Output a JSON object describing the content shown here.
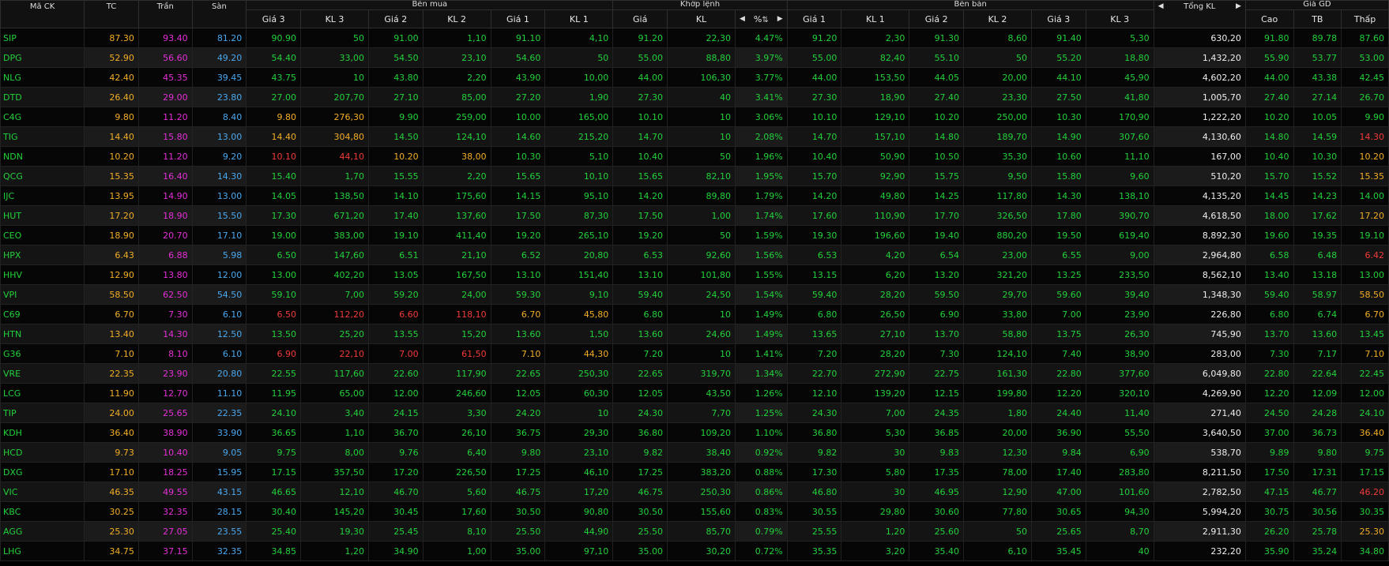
{
  "columns": {
    "symbol": "Mã CK",
    "ref": "TC",
    "ceiling": "Trần",
    "floor": "Sàn",
    "buy_group": "Bên mua",
    "match_group": "Khớp lệnh",
    "sell_group": "Bên bán",
    "total_volume": "Tổng KL",
    "price_group": "Giá GD",
    "price3": "Giá 3",
    "vol3": "KL 3",
    "price2": "Giá 2",
    "vol2": "KL 2",
    "price1": "Giá 1",
    "vol1": "KL 1",
    "match_price": "Giá",
    "match_vol": "KL",
    "change_pct": "%",
    "high": "Cao",
    "avg": "TB",
    "low": "Thấp"
  },
  "icons": {
    "left_arrow": "◀",
    "right_arrow": "▶",
    "sort": "⇅"
  },
  "colors": {
    "up": "#22d13a",
    "ref": "#f2ae25",
    "ceiling": "#e52fd8",
    "floor": "#49a8f0",
    "down": "#f23a3a",
    "neutral": "#efefef"
  },
  "rows": [
    {
      "sym": "SIP",
      "tc": "87.30",
      "ceil": "93.40",
      "floor": "81.20",
      "b3": "90.90",
      "bv3": "50",
      "b2": "91.00",
      "bv2": "1,10",
      "b1": "91.10",
      "bv1": "4,10",
      "mp": "91.20",
      "mv": "22,30",
      "pct": "4.47%",
      "s1": "91.20",
      "sv1": "2,30",
      "s2": "91.30",
      "sv2": "8,60",
      "s3": "91.40",
      "sv3": "5,30",
      "tot": "630,20",
      "hi": "91.80",
      "avg": "89.78",
      "lo": "87.60"
    },
    {
      "sym": "DPG",
      "tc": "52.90",
      "ceil": "56.60",
      "floor": "49.20",
      "b3": "54.40",
      "bv3": "33,00",
      "b2": "54.50",
      "bv2": "23,10",
      "b1": "54.60",
      "bv1": "50",
      "mp": "55.00",
      "mv": "88,80",
      "pct": "3.97%",
      "s1": "55.00",
      "sv1": "82,40",
      "s2": "55.10",
      "sv2": "50",
      "s3": "55.20",
      "sv3": "18,80",
      "tot": "1,432,20",
      "hi": "55.90",
      "avg": "53.77",
      "lo": "53.00"
    },
    {
      "sym": "NLG",
      "tc": "42.40",
      "ceil": "45.35",
      "floor": "39.45",
      "b3": "43.75",
      "bv3": "10",
      "b2": "43.80",
      "bv2": "2,20",
      "b1": "43.90",
      "bv1": "10,00",
      "mp": "44.00",
      "mv": "106,30",
      "pct": "3.77%",
      "s1": "44.00",
      "sv1": "153,50",
      "s2": "44.05",
      "sv2": "20,00",
      "s3": "44.10",
      "sv3": "45,90",
      "tot": "4,602,20",
      "hi": "44.00",
      "avg": "43.38",
      "lo": "42.45"
    },
    {
      "sym": "DTD",
      "tc": "26.40",
      "ceil": "29.00",
      "floor": "23.80",
      "b3": "27.00",
      "bv3": "207,70",
      "b2": "27.10",
      "bv2": "85,00",
      "b1": "27.20",
      "bv1": "1,90",
      "mp": "27.30",
      "mv": "40",
      "pct": "3.41%",
      "s1": "27.30",
      "sv1": "18,90",
      "s2": "27.40",
      "sv2": "23,30",
      "s3": "27.50",
      "sv3": "41,80",
      "tot": "1,005,70",
      "hi": "27.40",
      "avg": "27.14",
      "lo": "26.70"
    },
    {
      "sym": "C4G",
      "tc": "9.80",
      "ceil": "11.20",
      "floor": "8.40",
      "b3": "9.80",
      "bv3": "276,30",
      "b2": "9.90",
      "bv2": "259,00",
      "b1": "10.00",
      "bv1": "165,00",
      "mp": "10.10",
      "mv": "10",
      "pct": "3.06%",
      "s1": "10.10",
      "sv1": "129,10",
      "s2": "10.20",
      "sv2": "250,00",
      "s3": "10.30",
      "sv3": "170,90",
      "tot": "1,222,20",
      "hi": "10.20",
      "avg": "10.05",
      "lo": "9.90"
    },
    {
      "sym": "TIG",
      "tc": "14.40",
      "ceil": "15.80",
      "floor": "13.00",
      "b3": "14.40",
      "bv3": "304,80",
      "b2": "14.50",
      "bv2": "124,10",
      "b1": "14.60",
      "bv1": "215,20",
      "mp": "14.70",
      "mv": "10",
      "pct": "2.08%",
      "s1": "14.70",
      "sv1": "157,10",
      "s2": "14.80",
      "sv2": "189,70",
      "s3": "14.90",
      "sv3": "307,60",
      "tot": "4,130,60",
      "hi": "14.80",
      "avg": "14.59",
      "lo": "14.30"
    },
    {
      "sym": "NDN",
      "tc": "10.20",
      "ceil": "11.20",
      "floor": "9.20",
      "b3": "10.10",
      "bv3": "44,10",
      "b2": "10.20",
      "bv2": "38,00",
      "b1": "10.30",
      "bv1": "5,10",
      "mp": "10.40",
      "mv": "50",
      "pct": "1.96%",
      "s1": "10.40",
      "sv1": "50,90",
      "s2": "10.50",
      "sv2": "35,30",
      "s3": "10.60",
      "sv3": "11,10",
      "tot": "167,00",
      "hi": "10.40",
      "avg": "10.30",
      "lo": "10.20"
    },
    {
      "sym": "QCG",
      "tc": "15.35",
      "ceil": "16.40",
      "floor": "14.30",
      "b3": "15.40",
      "bv3": "1,70",
      "b2": "15.55",
      "bv2": "2,20",
      "b1": "15.65",
      "bv1": "10,10",
      "mp": "15.65",
      "mv": "82,10",
      "pct": "1.95%",
      "s1": "15.70",
      "sv1": "92,90",
      "s2": "15.75",
      "sv2": "9,50",
      "s3": "15.80",
      "sv3": "9,60",
      "tot": "510,20",
      "hi": "15.70",
      "avg": "15.52",
      "lo": "15.35"
    },
    {
      "sym": "IJC",
      "tc": "13.95",
      "ceil": "14.90",
      "floor": "13.00",
      "b3": "14.05",
      "bv3": "138,50",
      "b2": "14.10",
      "bv2": "175,60",
      "b1": "14.15",
      "bv1": "95,10",
      "mp": "14.20",
      "mv": "89,80",
      "pct": "1.79%",
      "s1": "14.20",
      "sv1": "49,80",
      "s2": "14.25",
      "sv2": "117,80",
      "s3": "14.30",
      "sv3": "138,10",
      "tot": "4,135,20",
      "hi": "14.45",
      "avg": "14.23",
      "lo": "14.00"
    },
    {
      "sym": "HUT",
      "tc": "17.20",
      "ceil": "18.90",
      "floor": "15.50",
      "b3": "17.30",
      "bv3": "671,20",
      "b2": "17.40",
      "bv2": "137,60",
      "b1": "17.50",
      "bv1": "87,30",
      "mp": "17.50",
      "mv": "1,00",
      "pct": "1.74%",
      "s1": "17.60",
      "sv1": "110,90",
      "s2": "17.70",
      "sv2": "326,50",
      "s3": "17.80",
      "sv3": "390,70",
      "tot": "4,618,50",
      "hi": "18.00",
      "avg": "17.62",
      "lo": "17.20"
    },
    {
      "sym": "CEO",
      "tc": "18.90",
      "ceil": "20.70",
      "floor": "17.10",
      "b3": "19.00",
      "bv3": "383,00",
      "b2": "19.10",
      "bv2": "411,40",
      "b1": "19.20",
      "bv1": "265,10",
      "mp": "19.20",
      "mv": "50",
      "pct": "1.59%",
      "s1": "19.30",
      "sv1": "196,60",
      "s2": "19.40",
      "sv2": "880,20",
      "s3": "19.50",
      "sv3": "619,40",
      "tot": "8,892,30",
      "hi": "19.60",
      "avg": "19.35",
      "lo": "19.10"
    },
    {
      "sym": "HPX",
      "tc": "6.43",
      "ceil": "6.88",
      "floor": "5.98",
      "b3": "6.50",
      "bv3": "147,60",
      "b2": "6.51",
      "bv2": "21,10",
      "b1": "6.52",
      "bv1": "20,80",
      "mp": "6.53",
      "mv": "92,60",
      "pct": "1.56%",
      "s1": "6.53",
      "sv1": "4,20",
      "s2": "6.54",
      "sv2": "23,00",
      "s3": "6.55",
      "sv3": "9,00",
      "tot": "2,964,80",
      "hi": "6.58",
      "avg": "6.48",
      "lo": "6.42"
    },
    {
      "sym": "HHV",
      "tc": "12.90",
      "ceil": "13.80",
      "floor": "12.00",
      "b3": "13.00",
      "bv3": "402,20",
      "b2": "13.05",
      "bv2": "167,50",
      "b1": "13.10",
      "bv1": "151,40",
      "mp": "13.10",
      "mv": "101,80",
      "pct": "1.55%",
      "s1": "13.15",
      "sv1": "6,20",
      "s2": "13.20",
      "sv2": "321,20",
      "s3": "13.25",
      "sv3": "233,50",
      "tot": "8,562,10",
      "hi": "13.40",
      "avg": "13.18",
      "lo": "13.00"
    },
    {
      "sym": "VPI",
      "tc": "58.50",
      "ceil": "62.50",
      "floor": "54.50",
      "b3": "59.10",
      "bv3": "7,00",
      "b2": "59.20",
      "bv2": "24,00",
      "b1": "59.30",
      "bv1": "9,10",
      "mp": "59.40",
      "mv": "24,50",
      "pct": "1.54%",
      "s1": "59.40",
      "sv1": "28,20",
      "s2": "59.50",
      "sv2": "29,70",
      "s3": "59.60",
      "sv3": "39,40",
      "tot": "1,348,30",
      "hi": "59.40",
      "avg": "58.97",
      "lo": "58.50"
    },
    {
      "sym": "C69",
      "tc": "6.70",
      "ceil": "7.30",
      "floor": "6.10",
      "b3": "6.50",
      "bv3": "112,20",
      "b2": "6.60",
      "bv2": "118,10",
      "b1": "6.70",
      "bv1": "45,80",
      "mp": "6.80",
      "mv": "10",
      "pct": "1.49%",
      "s1": "6.80",
      "sv1": "26,50",
      "s2": "6.90",
      "sv2": "33,80",
      "s3": "7.00",
      "sv3": "23,90",
      "tot": "226,80",
      "hi": "6.80",
      "avg": "6.74",
      "lo": "6.70"
    },
    {
      "sym": "HTN",
      "tc": "13.40",
      "ceil": "14.30",
      "floor": "12.50",
      "b3": "13.50",
      "bv3": "25,20",
      "b2": "13.55",
      "bv2": "15,20",
      "b1": "13.60",
      "bv1": "1,50",
      "mp": "13.60",
      "mv": "24,60",
      "pct": "1.49%",
      "s1": "13.65",
      "sv1": "27,10",
      "s2": "13.70",
      "sv2": "58,80",
      "s3": "13.75",
      "sv3": "26,30",
      "tot": "745,90",
      "hi": "13.70",
      "avg": "13.60",
      "lo": "13.45"
    },
    {
      "sym": "G36",
      "tc": "7.10",
      "ceil": "8.10",
      "floor": "6.10",
      "b3": "6.90",
      "bv3": "22,10",
      "b2": "7.00",
      "bv2": "61,50",
      "b1": "7.10",
      "bv1": "44,30",
      "mp": "7.20",
      "mv": "10",
      "pct": "1.41%",
      "s1": "7.20",
      "sv1": "28,20",
      "s2": "7.30",
      "sv2": "124,10",
      "s3": "7.40",
      "sv3": "38,90",
      "tot": "283,00",
      "hi": "7.30",
      "avg": "7.17",
      "lo": "7.10"
    },
    {
      "sym": "VRE",
      "tc": "22.35",
      "ceil": "23.90",
      "floor": "20.80",
      "b3": "22.55",
      "bv3": "117,60",
      "b2": "22.60",
      "bv2": "117,90",
      "b1": "22.65",
      "bv1": "250,30",
      "mp": "22.65",
      "mv": "319,70",
      "pct": "1.34%",
      "s1": "22.70",
      "sv1": "272,90",
      "s2": "22.75",
      "sv2": "161,30",
      "s3": "22.80",
      "sv3": "377,60",
      "tot": "6,049,80",
      "hi": "22.80",
      "avg": "22.64",
      "lo": "22.45"
    },
    {
      "sym": "LCG",
      "tc": "11.90",
      "ceil": "12.70",
      "floor": "11.10",
      "b3": "11.95",
      "bv3": "65,00",
      "b2": "12.00",
      "bv2": "246,60",
      "b1": "12.05",
      "bv1": "60,30",
      "mp": "12.05",
      "mv": "43,50",
      "pct": "1.26%",
      "s1": "12.10",
      "sv1": "139,20",
      "s2": "12.15",
      "sv2": "199,80",
      "s3": "12.20",
      "sv3": "320,10",
      "tot": "4,269,90",
      "hi": "12.20",
      "avg": "12.09",
      "lo": "12.00"
    },
    {
      "sym": "TIP",
      "tc": "24.00",
      "ceil": "25.65",
      "floor": "22.35",
      "b3": "24.10",
      "bv3": "3,40",
      "b2": "24.15",
      "bv2": "3,30",
      "b1": "24.20",
      "bv1": "10",
      "mp": "24.30",
      "mv": "7,70",
      "pct": "1.25%",
      "s1": "24.30",
      "sv1": "7,00",
      "s2": "24.35",
      "sv2": "1,80",
      "s3": "24.40",
      "sv3": "11,40",
      "tot": "271,40",
      "hi": "24.50",
      "avg": "24.28",
      "lo": "24.10"
    },
    {
      "sym": "KDH",
      "tc": "36.40",
      "ceil": "38.90",
      "floor": "33.90",
      "b3": "36.65",
      "bv3": "1,10",
      "b2": "36.70",
      "bv2": "26,10",
      "b1": "36.75",
      "bv1": "29,30",
      "mp": "36.80",
      "mv": "109,20",
      "pct": "1.10%",
      "s1": "36.80",
      "sv1": "5,30",
      "s2": "36.85",
      "sv2": "20,00",
      "s3": "36.90",
      "sv3": "55,50",
      "tot": "3,640,50",
      "hi": "37.00",
      "avg": "36.73",
      "lo": "36.40"
    },
    {
      "sym": "HCD",
      "tc": "9.73",
      "ceil": "10.40",
      "floor": "9.05",
      "b3": "9.75",
      "bv3": "8,00",
      "b2": "9.76",
      "bv2": "6,40",
      "b1": "9.80",
      "bv1": "23,10",
      "mp": "9.82",
      "mv": "38,40",
      "pct": "0.92%",
      "s1": "9.82",
      "sv1": "30",
      "s2": "9.83",
      "sv2": "12,30",
      "s3": "9.84",
      "sv3": "6,90",
      "tot": "538,70",
      "hi": "9.89",
      "avg": "9.80",
      "lo": "9.75"
    },
    {
      "sym": "DXG",
      "tc": "17.10",
      "ceil": "18.25",
      "floor": "15.95",
      "b3": "17.15",
      "bv3": "357,50",
      "b2": "17.20",
      "bv2": "226,50",
      "b1": "17.25",
      "bv1": "46,10",
      "mp": "17.25",
      "mv": "383,20",
      "pct": "0.88%",
      "s1": "17.30",
      "sv1": "5,80",
      "s2": "17.35",
      "sv2": "78,00",
      "s3": "17.40",
      "sv3": "283,80",
      "tot": "8,211,50",
      "hi": "17.50",
      "avg": "17.31",
      "lo": "17.15"
    },
    {
      "sym": "VIC",
      "tc": "46.35",
      "ceil": "49.55",
      "floor": "43.15",
      "b3": "46.65",
      "bv3": "12,10",
      "b2": "46.70",
      "bv2": "5,60",
      "b1": "46.75",
      "bv1": "17,20",
      "mp": "46.75",
      "mv": "250,30",
      "pct": "0.86%",
      "s1": "46.80",
      "sv1": "30",
      "s2": "46.95",
      "sv2": "12,90",
      "s3": "47.00",
      "sv3": "101,60",
      "tot": "2,782,50",
      "hi": "47.15",
      "avg": "46.77",
      "lo": "46.20"
    },
    {
      "sym": "KBC",
      "tc": "30.25",
      "ceil": "32.35",
      "floor": "28.15",
      "b3": "30.40",
      "bv3": "145,20",
      "b2": "30.45",
      "bv2": "17,60",
      "b1": "30.50",
      "bv1": "90,80",
      "mp": "30.50",
      "mv": "155,60",
      "pct": "0.83%",
      "s1": "30.55",
      "sv1": "29,80",
      "s2": "30.60",
      "sv2": "77,80",
      "s3": "30.65",
      "sv3": "94,30",
      "tot": "5,994,20",
      "hi": "30.75",
      "avg": "30.56",
      "lo": "30.35"
    },
    {
      "sym": "AGG",
      "tc": "25.30",
      "ceil": "27.05",
      "floor": "23.55",
      "b3": "25.40",
      "bv3": "19,30",
      "b2": "25.45",
      "bv2": "8,10",
      "b1": "25.50",
      "bv1": "44,90",
      "mp": "25.50",
      "mv": "85,70",
      "pct": "0.79%",
      "s1": "25.55",
      "sv1": "1,20",
      "s2": "25.60",
      "sv2": "50",
      "s3": "25.65",
      "sv3": "8,70",
      "tot": "2,911,30",
      "hi": "26.20",
      "avg": "25.78",
      "lo": "25.30"
    },
    {
      "sym": "LHG",
      "tc": "34.75",
      "ceil": "37.15",
      "floor": "32.35",
      "b3": "34.85",
      "bv3": "1,20",
      "b2": "34.90",
      "bv2": "1,00",
      "b1": "35.00",
      "bv1": "97,10",
      "mp": "35.00",
      "mv": "30,20",
      "pct": "0.72%",
      "s1": "35.35",
      "sv1": "3,20",
      "s2": "35.40",
      "sv2": "6,10",
      "s3": "35.45",
      "sv3": "40",
      "tot": "232,20",
      "hi": "35.90",
      "avg": "35.24",
      "lo": "34.80"
    }
  ]
}
